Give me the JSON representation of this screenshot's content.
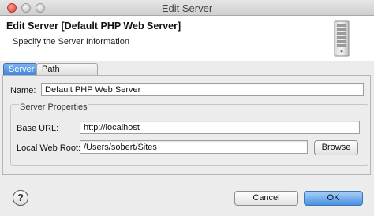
{
  "window": {
    "title": "Edit Server"
  },
  "header": {
    "title": "Edit Server [Default PHP Web Server]",
    "subtitle": "Specify the Server Information",
    "icon": "server-icon"
  },
  "tabs": [
    {
      "label": "Server",
      "active": true
    },
    {
      "label": "Path Mapping",
      "active": false
    }
  ],
  "server_tab": {
    "name_label": "Name:",
    "name_value": "Default PHP Web Server",
    "properties_title": "Server Properties",
    "base_url_label": "Base URL:",
    "base_url_value": "http://localhost",
    "web_root_label": "Local Web Root:",
    "web_root_value": "/Users/sobert/Sites",
    "browse_label": "Browse"
  },
  "footer": {
    "help_icon": "help-icon",
    "cancel_label": "Cancel",
    "ok_label": "OK"
  },
  "colors": {
    "accent": "#4a90e2",
    "close_button": "#d9423a"
  }
}
